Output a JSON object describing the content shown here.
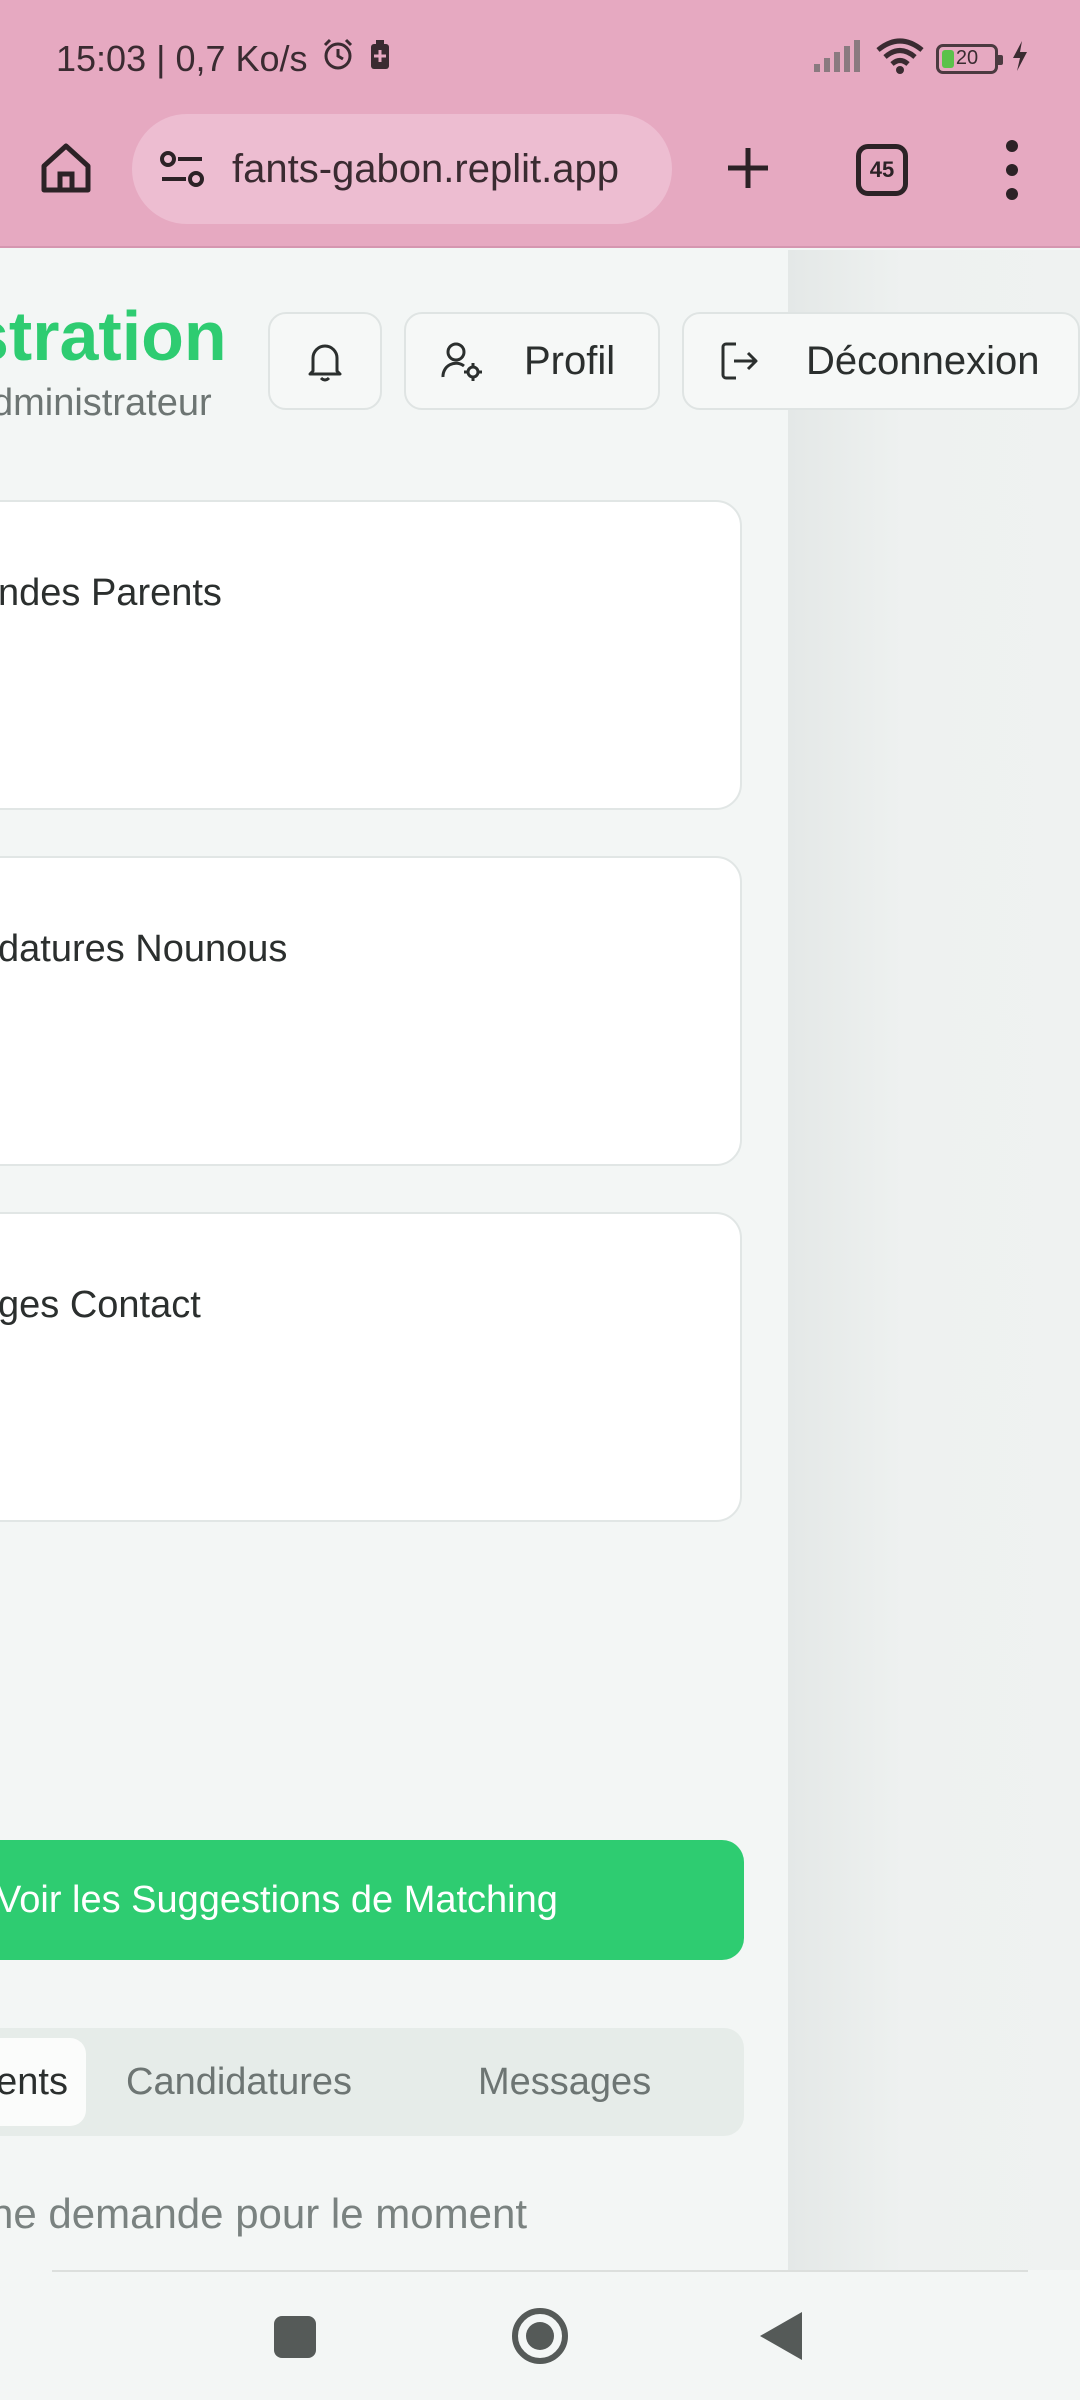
{
  "status_bar": {
    "time_speed": "15:03 | 0,7 Ko/s",
    "battery": "20"
  },
  "browser": {
    "url": "fants-gabon.replit.app",
    "tab_count": "45"
  },
  "header": {
    "title": "stration",
    "subtitle": "dministrateur",
    "profile_label": "Profil",
    "logout_label": "Déconnexion"
  },
  "cards": [
    {
      "label": "ndes Parents"
    },
    {
      "label": "datures Nounous"
    },
    {
      "label": "ges Contact"
    }
  ],
  "matching_button": "Voir les Suggestions de Matching",
  "tabs": [
    {
      "label": "arents",
      "active": true
    },
    {
      "label": "Candidatures",
      "active": false
    },
    {
      "label": "Messages",
      "active": false
    }
  ],
  "empty_message": "ne demande pour le moment",
  "colors": {
    "accent": "#2ecc71",
    "browser_bar": "#e6a9c1"
  }
}
